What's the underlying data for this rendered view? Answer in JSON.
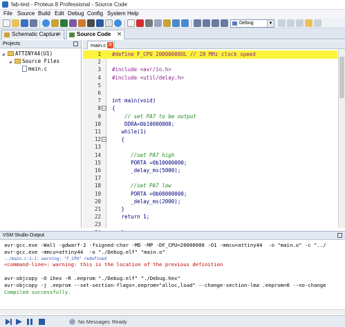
{
  "window": {
    "title": "fab-test - Proteus 8 Professional - Source Code"
  },
  "menu": [
    "File",
    "Source",
    "Build",
    "Edit",
    "Debug",
    "Config",
    "System",
    "Help"
  ],
  "toolbar": {
    "build_config": "Debug"
  },
  "tabs": [
    {
      "label": "Schematic Capture",
      "active": false
    },
    {
      "label": "Source Code",
      "active": true
    }
  ],
  "projects": {
    "header": "Projects",
    "tree": [
      {
        "label": "ATTINY44(U1)",
        "level": 0
      },
      {
        "label": "Source Files",
        "level": 1
      },
      {
        "label": "main.c",
        "level": 2
      }
    ]
  },
  "editor": {
    "file_tab": "main.c",
    "lines": [
      {
        "n": "1",
        "text": "#define F_CPU 20000000UL // 20 MHz clock speed",
        "cls": "c-pp",
        "hl": true
      },
      {
        "n": "2",
        "text": "",
        "cls": ""
      },
      {
        "n": "3",
        "text": "#include <avr/io.h>",
        "cls": "c-pp"
      },
      {
        "n": "4",
        "text": "#include <util/delay.h>",
        "cls": "c-pp"
      },
      {
        "n": "5",
        "text": "",
        "cls": ""
      },
      {
        "n": "6",
        "text": "",
        "cls": ""
      },
      {
        "n": "7",
        "text": "int main(void)",
        "cls": "c-plain"
      },
      {
        "n": "8",
        "text": "{",
        "cls": "c-plain",
        "fold": "−"
      },
      {
        "n": "9",
        "text": "    // set PA7 to be output",
        "cls": "c-cm"
      },
      {
        "n": "10",
        "text": "    DDRA=0b10000000;",
        "cls": "c-plain"
      },
      {
        "n": "11",
        "text": "   while(1)",
        "cls": "c-plain"
      },
      {
        "n": "12",
        "text": "   {",
        "cls": "c-plain",
        "fold": "−"
      },
      {
        "n": "13",
        "text": "",
        "cls": ""
      },
      {
        "n": "14",
        "text": "      //set PA7 high",
        "cls": "c-cm"
      },
      {
        "n": "15",
        "text": "      PORTA =0b10000000;",
        "cls": "c-plain"
      },
      {
        "n": "16",
        "text": "      _delay_ms(5000);",
        "cls": "c-plain"
      },
      {
        "n": "17",
        "text": "",
        "cls": ""
      },
      {
        "n": "18",
        "text": "      //set PA7 low",
        "cls": "c-cm"
      },
      {
        "n": "19",
        "text": "      PORTA =0b00000000;",
        "cls": "c-plain"
      },
      {
        "n": "20",
        "text": "      _delay_ms(2000);",
        "cls": "c-plain"
      },
      {
        "n": "21",
        "text": "   }",
        "cls": "c-plain"
      },
      {
        "n": "22",
        "text": "   return 1;",
        "cls": "c-plain"
      },
      {
        "n": "23",
        "text": "",
        "cls": ""
      },
      {
        "n": "24",
        "text": "   }",
        "cls": "c-plain"
      }
    ]
  },
  "output": {
    "header": "VSM Studio Output",
    "lines": [
      {
        "text": "avr-gcc.exe -Wall -gdwarf-2 -fsigned-char -MD -MP -DF_CPU=20000000 -O1 -mmcu=attiny44  -o \"main.o\" -c \"../",
        "cls": ""
      },
      {
        "text": "avr-gcc.exe -mmcu=attiny44  -o \"./Debug.elf\" \"main.o\"",
        "cls": ""
      },
      {
        "text": "../main.c:1:1: warning: \"F_CPU\" redefined",
        "cls": "small"
      },
      {
        "text": "<command-line>: warning: this is the location of the previous definition",
        "cls": "red"
      },
      {
        "text": "",
        "cls": ""
      },
      {
        "text": "avr-objcopy -O ihex -R .eeprom \"./Debug.elf\" \"./Debug.hex\"",
        "cls": ""
      },
      {
        "text": "avr-objcopy -j .eeprom --set-section-flags=.eeprom=\"alloc,load\" --change-section-lma .eeprom=0 --no-change",
        "cls": ""
      },
      {
        "text": "Compiled successfully.",
        "cls": "green"
      }
    ]
  },
  "status": {
    "messages": "No Messages",
    "state": "Ready"
  }
}
